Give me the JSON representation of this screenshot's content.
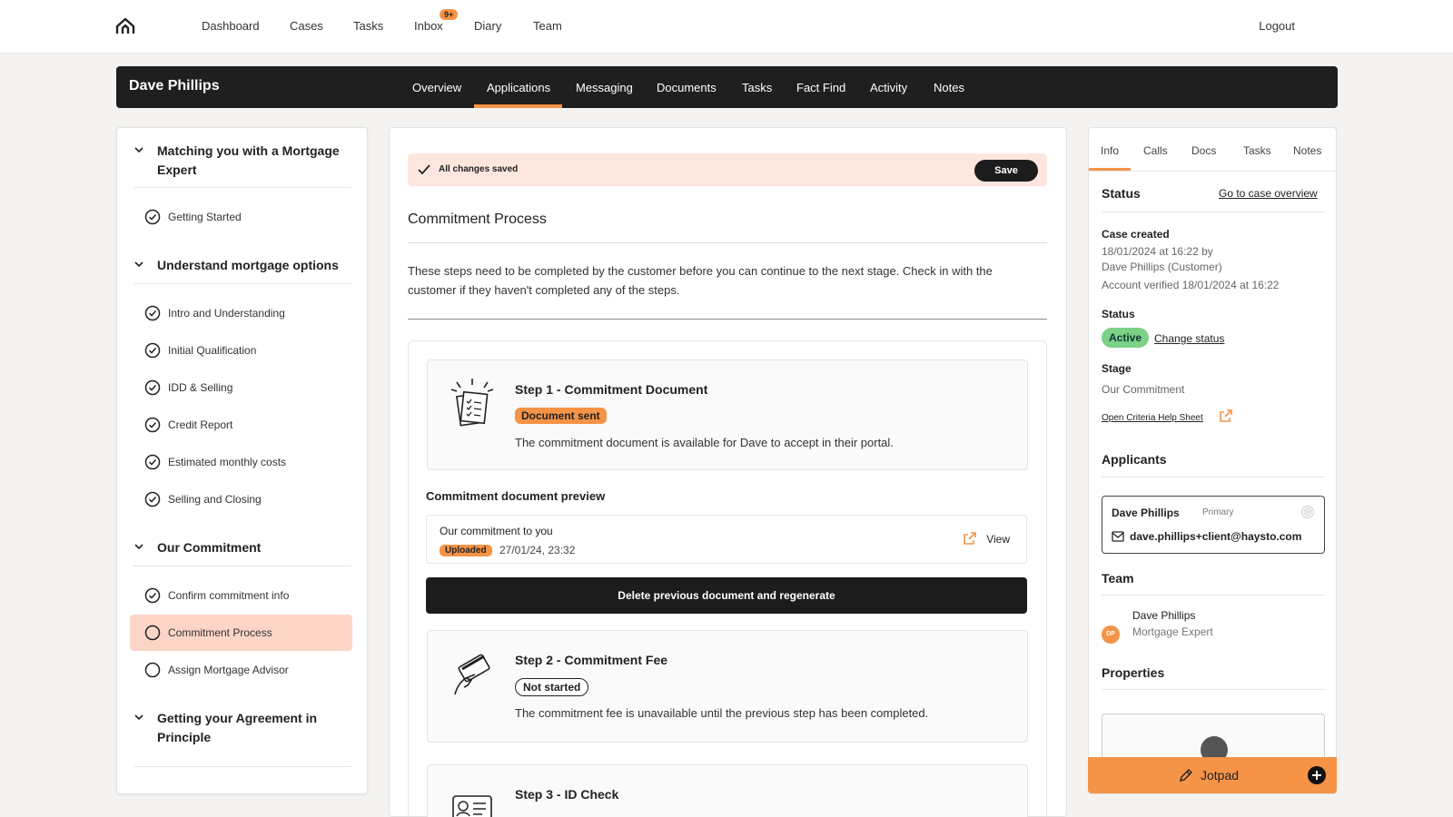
{
  "topnav": {
    "items": [
      "Dashboard",
      "Cases",
      "Tasks",
      "Inbox",
      "Diary",
      "Team"
    ],
    "inbox_badge": "9+",
    "logout": "Logout"
  },
  "case": {
    "name": "Dave Phillips",
    "tabs": [
      "Overview",
      "Applications",
      "Messaging",
      "Documents",
      "Tasks",
      "Fact Find",
      "Activity",
      "Notes"
    ],
    "active_tab": "Applications"
  },
  "sidebar": {
    "sections": [
      {
        "title": "Matching you with a Mortgage Expert",
        "items": [
          {
            "label": "Getting Started",
            "done": true
          }
        ]
      },
      {
        "title": "Understand mortgage options",
        "items": [
          {
            "label": "Intro and Understanding",
            "done": true
          },
          {
            "label": "Initial Qualification",
            "done": true
          },
          {
            "label": "IDD & Selling",
            "done": true
          },
          {
            "label": "Credit Report",
            "done": true
          },
          {
            "label": "Estimated monthly costs",
            "done": true
          },
          {
            "label": "Selling and Closing",
            "done": true
          }
        ]
      },
      {
        "title": "Our Commitment",
        "items": [
          {
            "label": "Confirm commitment info",
            "done": true
          },
          {
            "label": "Commitment Process",
            "done": false,
            "active": true
          },
          {
            "label": "Assign Mortgage Advisor",
            "done": false
          }
        ]
      },
      {
        "title": "Getting your Agreement in Principle",
        "items": []
      }
    ]
  },
  "main": {
    "save_status": "All changes saved",
    "save_label": "Save",
    "title": "Commitment Process",
    "intro": "These steps need to be completed by the customer before you can continue to the next stage. Check in with the customer if they haven't completed any of the steps.",
    "steps": [
      {
        "title": "Step 1 - Commitment Document",
        "status": "Document sent",
        "description": "The commitment document is available for Dave to accept in their portal."
      },
      {
        "title": "Step 2 - Commitment Fee",
        "status": "Not started",
        "description": "The commitment fee is unavailable until the previous step has been completed."
      },
      {
        "title": "Step 3 - ID Check"
      }
    ],
    "preview": {
      "label": "Commitment document preview",
      "doc_title": "Our commitment to you",
      "doc_badge": "Uploaded",
      "doc_date": "27/01/24, 23:32",
      "view_label": "View"
    },
    "regenerate_label": "Delete previous document and regenerate"
  },
  "right": {
    "tabs": [
      "Info",
      "Calls",
      "Docs",
      "Tasks",
      "Notes"
    ],
    "active_tab": "Info",
    "status_heading": "Status",
    "case_overview_link": "Go to case overview",
    "case_created_label": "Case created",
    "case_created_line1": "18/01/2024 at 16:22 by",
    "case_created_line2": "Dave Phillips (Customer)",
    "account_verified": "Account verified 18/01/2024 at 16:22",
    "status_label": "Status",
    "status_value": "Active",
    "change_status": "Change status",
    "stage_label": "Stage",
    "stage_value": "Our Commitment",
    "criteria_link": "Open Criteria Help Sheet",
    "applicants_heading": "Applicants",
    "applicant_name": "Dave Phillips",
    "applicant_role": "Primary",
    "applicant_email": "dave.phillips+client@haysto.com",
    "team_heading": "Team",
    "team_member_initials": "DP",
    "team_member_name": "Dave Phillips",
    "team_member_role": "Mortgage Expert",
    "properties_heading": "Properties",
    "jotpad_label": "Jotpad"
  },
  "colors": {
    "accent": "#f59347",
    "dark": "#1f1f1f",
    "active_green": "#7bd186",
    "highlight": "#fcd5c7"
  }
}
